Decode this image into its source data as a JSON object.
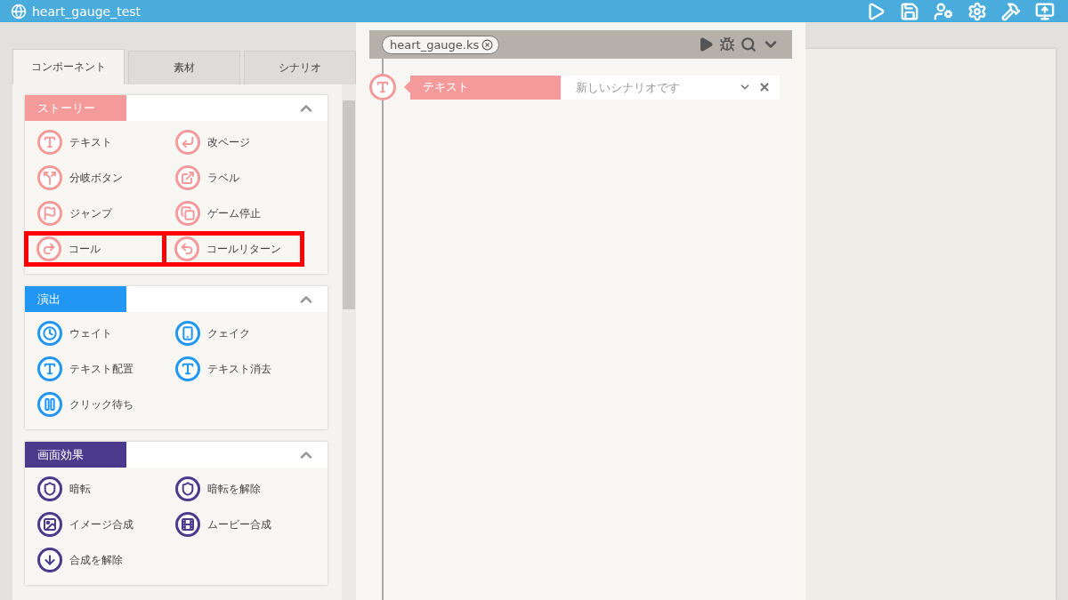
{
  "window": {
    "title": "heart_gauge_test"
  },
  "tabs": [
    {
      "label": "コンポーネント",
      "selected": true
    },
    {
      "label": "素材",
      "selected": false
    },
    {
      "label": "シナリオ",
      "selected": false
    }
  ],
  "sections": [
    {
      "title": "ストーリー",
      "color": "#f59a9a",
      "expanded": true,
      "items": [
        {
          "label": "テキスト",
          "highlighted": false
        },
        {
          "label": "改ページ",
          "highlighted": false
        },
        {
          "label": "分岐ボタン",
          "highlighted": false
        },
        {
          "label": "ラベル",
          "highlighted": false
        },
        {
          "label": "ジャンプ",
          "highlighted": false
        },
        {
          "label": "ゲーム停止",
          "highlighted": false
        },
        {
          "label": "コール",
          "highlighted": true
        },
        {
          "label": "コールリターン",
          "highlighted": true
        }
      ]
    },
    {
      "title": "演出",
      "color": "#2196f3",
      "expanded": true,
      "items": [
        {
          "label": "ウェイト",
          "highlighted": false
        },
        {
          "label": "クェイク",
          "highlighted": false
        },
        {
          "label": "テキスト配置",
          "highlighted": false
        },
        {
          "label": "テキスト消去",
          "highlighted": false
        },
        {
          "label": "クリック待ち",
          "highlighted": false
        }
      ]
    },
    {
      "title": "画面効果",
      "color": "#4b3a8c",
      "expanded": true,
      "items": [
        {
          "label": "暗転",
          "highlighted": false
        },
        {
          "label": "暗転を解除",
          "highlighted": false
        },
        {
          "label": "イメージ合成",
          "highlighted": false
        },
        {
          "label": "ムービー合成",
          "highlighted": false
        },
        {
          "label": "合成を解除",
          "highlighted": false
        }
      ]
    }
  ],
  "editor": {
    "file_tab": "heart_gauge.ks",
    "blocks": [
      {
        "label": "テキスト",
        "placeholder": "新しいシナリオです"
      }
    ]
  }
}
